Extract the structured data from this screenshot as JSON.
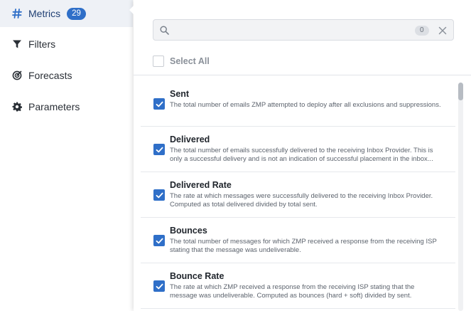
{
  "nav": {
    "items": [
      {
        "label": "Metrics",
        "icon": "hash-icon",
        "count": "29",
        "active": true
      },
      {
        "label": "Filters",
        "icon": "filter-icon"
      },
      {
        "label": "Forecasts",
        "icon": "radar-icon"
      },
      {
        "label": "Parameters",
        "icon": "gear-icon"
      }
    ]
  },
  "search": {
    "value": "",
    "placeholder": "",
    "result_count": "0"
  },
  "select_all": {
    "label": "Select All",
    "checked": false
  },
  "metrics": [
    {
      "title": "Sent",
      "checked": true,
      "description": "The total number of emails ZMP attempted to deploy after all exclusions and suppressions."
    },
    {
      "title": "Delivered",
      "checked": true,
      "description": "The total number of emails successfully delivered to the receiving Inbox Provider. This is only a successful delivery and is not an indication of successful placement in the inbox..."
    },
    {
      "title": "Delivered Rate",
      "checked": true,
      "description": "The rate at which messages were successfully delivered to the receiving Inbox Provider. Computed as total delivered divided by total sent."
    },
    {
      "title": "Bounces",
      "checked": true,
      "description": "The total number of messages for which ZMP received a response from the receiving ISP stating that the message was undeliverable."
    },
    {
      "title": "Bounce Rate",
      "checked": true,
      "description": "The rate at which ZMP received a response from the receiving ISP stating that the message was undeliverable. Computed as bounces (hard + soft) divided by sent."
    }
  ],
  "colors": {
    "accent": "#2f6fc8",
    "active_nav_bg": "#eef1f6"
  }
}
